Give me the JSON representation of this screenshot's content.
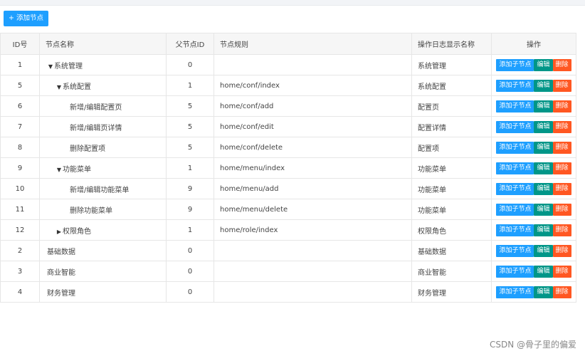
{
  "toolbar": {
    "add_node_label": "+ 添加节点"
  },
  "table": {
    "columns": [
      "ID号",
      "节点名称",
      "父节点ID",
      "节点规则",
      "操作日志显示名称",
      "操作"
    ],
    "op_labels": {
      "add_child": "添加子节点",
      "edit": "编辑",
      "delete": "删除"
    },
    "rows": [
      {
        "id": "1",
        "name": "系统管理",
        "level": 0,
        "caret": "▼",
        "pid": "0",
        "rule": "",
        "log": "系统管理"
      },
      {
        "id": "5",
        "name": "系统配置",
        "level": 1,
        "caret": "▼",
        "pid": "1",
        "rule": "home/conf/index",
        "log": "系统配置"
      },
      {
        "id": "6",
        "name": "新增/编辑配置页",
        "level": 2,
        "caret": "",
        "pid": "5",
        "rule": "home/conf/add",
        "log": "配置页"
      },
      {
        "id": "7",
        "name": "新增/编辑页详情",
        "level": 2,
        "caret": "",
        "pid": "5",
        "rule": "home/conf/edit",
        "log": "配置详情"
      },
      {
        "id": "8",
        "name": "删除配置项",
        "level": 2,
        "caret": "",
        "pid": "5",
        "rule": "home/conf/delete",
        "log": "配置项"
      },
      {
        "id": "9",
        "name": "功能菜单",
        "level": 1,
        "caret": "▼",
        "pid": "1",
        "rule": "home/menu/index",
        "log": "功能菜单"
      },
      {
        "id": "10",
        "name": "新增/编辑功能菜单",
        "level": 2,
        "caret": "",
        "pid": "9",
        "rule": "home/menu/add",
        "log": "功能菜单"
      },
      {
        "id": "11",
        "name": "删除功能菜单",
        "level": 2,
        "caret": "",
        "pid": "9",
        "rule": "home/menu/delete",
        "log": "功能菜单"
      },
      {
        "id": "12",
        "name": "权限角色",
        "level": 1,
        "caret": "▶",
        "pid": "1",
        "rule": "home/role/index",
        "log": "权限角色"
      },
      {
        "id": "2",
        "name": "基础数据",
        "level": 0,
        "caret": "",
        "pid": "0",
        "rule": "",
        "log": "基础数据"
      },
      {
        "id": "3",
        "name": "商业智能",
        "level": 0,
        "caret": "",
        "pid": "0",
        "rule": "",
        "log": "商业智能"
      },
      {
        "id": "4",
        "name": "财务管理",
        "level": 0,
        "caret": "",
        "pid": "0",
        "rule": "",
        "log": "财务管理"
      }
    ]
  },
  "watermark": "CSDN @骨子里的偏爱"
}
